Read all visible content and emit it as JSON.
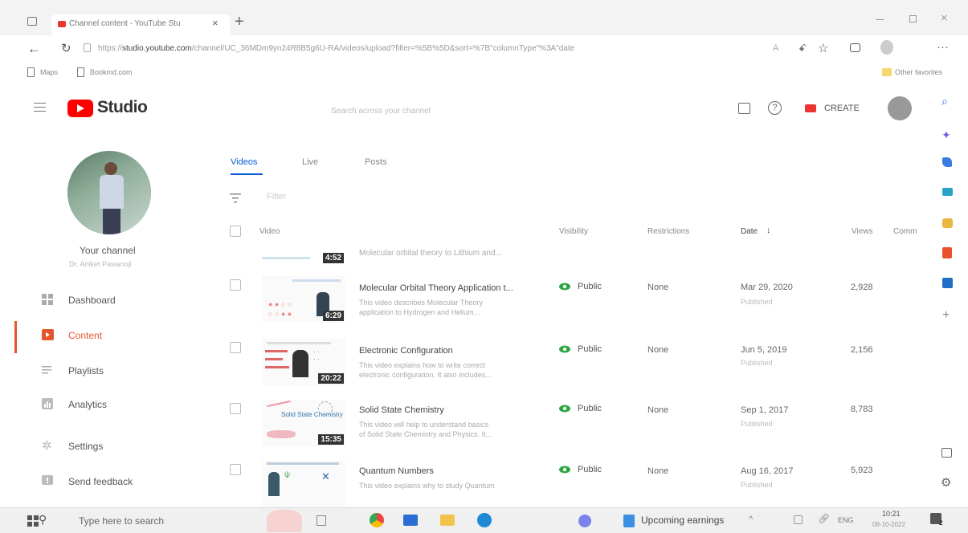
{
  "browser": {
    "tab_title": "Channel content - YouTube Stu",
    "new_tab": "+",
    "url_prefix": "https://",
    "url_domain": "studio.youtube.com",
    "url_rest": "/channel/UC_36MDm9yn24R8B5g6U-RA/videos/upload?filter=%5B%5D&sort=%7B\"columnType\"%3A\"date",
    "favorites": [
      {
        "label": "Maps"
      },
      {
        "label": "Bookmd.com"
      }
    ],
    "other_favorites": "Other favorites"
  },
  "studio": {
    "logo_text": "Studio",
    "search_placeholder": "Search across your channel",
    "create_label": "CREATE"
  },
  "sidebar": {
    "channel_label": "Your channel",
    "channel_name": "Dr. Aniket Pawanoji",
    "items": [
      {
        "label": "Dashboard"
      },
      {
        "label": "Content"
      },
      {
        "label": "Playlists"
      },
      {
        "label": "Analytics"
      },
      {
        "label": "Settings"
      },
      {
        "label": "Send feedback"
      }
    ]
  },
  "content": {
    "tabs": [
      "Videos",
      "Live",
      "Posts"
    ],
    "filter_placeholder": "Filter",
    "columns": {
      "video": "Video",
      "visibility": "Visibility",
      "restrictions": "Restrictions",
      "date": "Date",
      "views": "Views",
      "comments": "Comm"
    },
    "partial_row": {
      "duration": "4:52",
      "title": "Molecular orbital theory to Lithium and..."
    },
    "rows": [
      {
        "duration": "6:29",
        "title": "Molecular Orbital Theory Application t...",
        "desc1": "This video describes Molecular Theory",
        "desc2": "application to Hydrogen and Helium...",
        "visibility": "Public",
        "restrictions": "None",
        "date": "Mar 29, 2020",
        "status": "Published",
        "views": "2,928"
      },
      {
        "duration": "20:22",
        "title": "Electronic Configuration",
        "desc1": "This video explains how to write correct",
        "desc2": "electronic configuration. It also includes...",
        "visibility": "Public",
        "restrictions": "None",
        "date": "Jun 5, 2019",
        "status": "Published",
        "views": "2,156"
      },
      {
        "duration": "15:35",
        "title": "Solid State Chemistry",
        "desc1": "This video will help to understand basics",
        "desc2": "of Solid State Chemistry and Physics. It...",
        "visibility": "Public",
        "restrictions": "None",
        "date": "Sep 1, 2017",
        "status": "Published",
        "views": "8,783"
      },
      {
        "duration": "",
        "title": "Quantum Numbers",
        "desc1": "This video explains why to study Quantum",
        "desc2": "",
        "visibility": "Public",
        "restrictions": "None",
        "date": "Aug 16, 2017",
        "status": "Published",
        "views": "5,923"
      }
    ]
  },
  "taskbar": {
    "search_placeholder": "Type here to search",
    "news": "Upcoming earnings",
    "lang": "ENG",
    "time": "10:21",
    "date": "08-10-2022",
    "notif_count": "2"
  },
  "colors": {
    "youtube_red": "#ff0000",
    "accent_blue": "#065fd4",
    "public_green": "#2ba640",
    "content_red": "#e4572e"
  }
}
